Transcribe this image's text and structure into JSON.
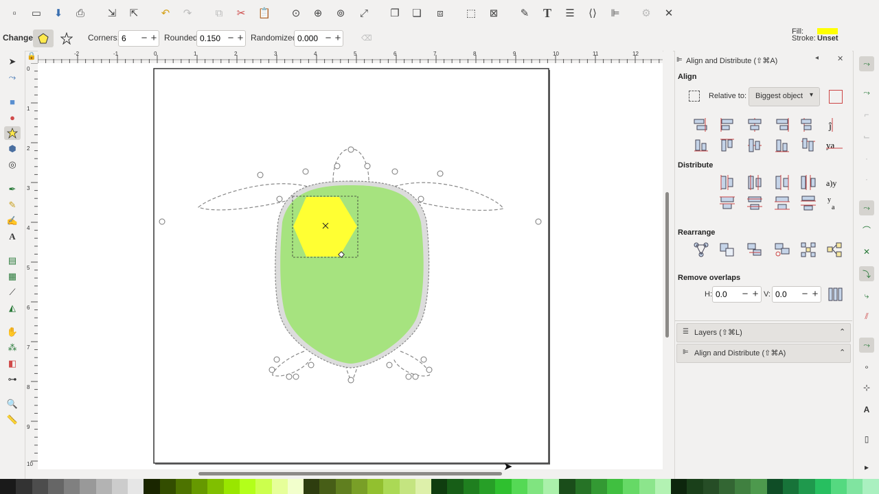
{
  "toolbar": {
    "icons": [
      "new-document",
      "open-document",
      "save-document",
      "print",
      "import",
      "export",
      "undo",
      "redo",
      "copy",
      "cut",
      "paste",
      "zoom-selection",
      "zoom-drawing",
      "zoom-page",
      "zoom-page-width",
      "duplicate",
      "clone",
      "unlink-clone",
      "group",
      "ungroup",
      "xml-editor-fill-stroke",
      "text",
      "layers",
      "xml-editor",
      "align-distribute",
      "preferences",
      "document-properties"
    ]
  },
  "controls": {
    "change_label": "Change:",
    "corners_label": "Corners:",
    "corners_value": "6",
    "rounded_label": "Rounded:",
    "rounded_value": "0.150",
    "randomized_label": "Randomized:",
    "randomized_value": "0.000",
    "fill_label": "Fill:",
    "stroke_label": "Stroke:",
    "stroke_value": "Unset",
    "fill_color": "#ffff00"
  },
  "rulers": {
    "h_ticks": [
      "-2",
      "-1",
      "0",
      "1",
      "2",
      "3",
      "4",
      "5",
      "6",
      "7",
      "8",
      "9",
      "10",
      "11",
      "12"
    ],
    "v_ticks": [
      "0",
      "1",
      "2",
      "3",
      "4",
      "5",
      "6",
      "7",
      "8",
      "9",
      "10"
    ]
  },
  "dock": {
    "panel_title": "Align and Distribute (⇧⌘A)",
    "align_heading": "Align",
    "relative_to_label": "Relative to:",
    "relative_to_value": "Biggest object",
    "distribute_heading": "Distribute",
    "rearrange_heading": "Rearrange",
    "remove_overlaps_heading": "Remove overlaps",
    "h_label": "H:",
    "h_value": "0.0",
    "v_label": "V:",
    "v_value": "0.0",
    "layers_tab": "Layers (⇧⌘L)",
    "align_tab": "Align and Distribute (⇧⌘A)"
  },
  "colors": {
    "accent": "#4a90d9",
    "turtle_body": "#a6e37f",
    "selected_fill": "#ffff33"
  },
  "palette": [
    "#1a1a1a",
    "#333333",
    "#4d4d4d",
    "#666666",
    "#808080",
    "#999999",
    "#b3b3b3",
    "#cccccc",
    "#e6e6e6",
    "#1a2600",
    "#334d00",
    "#4d7300",
    "#669900",
    "#80bf00",
    "#99e600",
    "#b3ff1a",
    "#ccff4d",
    "#e6ff99",
    "#f2ffcc",
    "#2e3d0f",
    "#475e17",
    "#607f1f",
    "#799f27",
    "#92c02f",
    "#abd955",
    "#c4e480",
    "#ddf0aa",
    "#0f3d0f",
    "#175e17",
    "#1f7f1f",
    "#279f27",
    "#2fc02f",
    "#55d955",
    "#80e480",
    "#aaf0aa",
    "#1a4d1a",
    "#267326",
    "#339933",
    "#40bf40",
    "#66d966",
    "#8ce58c",
    "#b3f2b3",
    "#0d260d",
    "#1a401a",
    "#264d26",
    "#336633",
    "#408040",
    "#4d994d",
    "#0f4d26",
    "#177339",
    "#1f994d",
    "#27bf60",
    "#55d980",
    "#80e4a0",
    "#aaf0c0"
  ]
}
